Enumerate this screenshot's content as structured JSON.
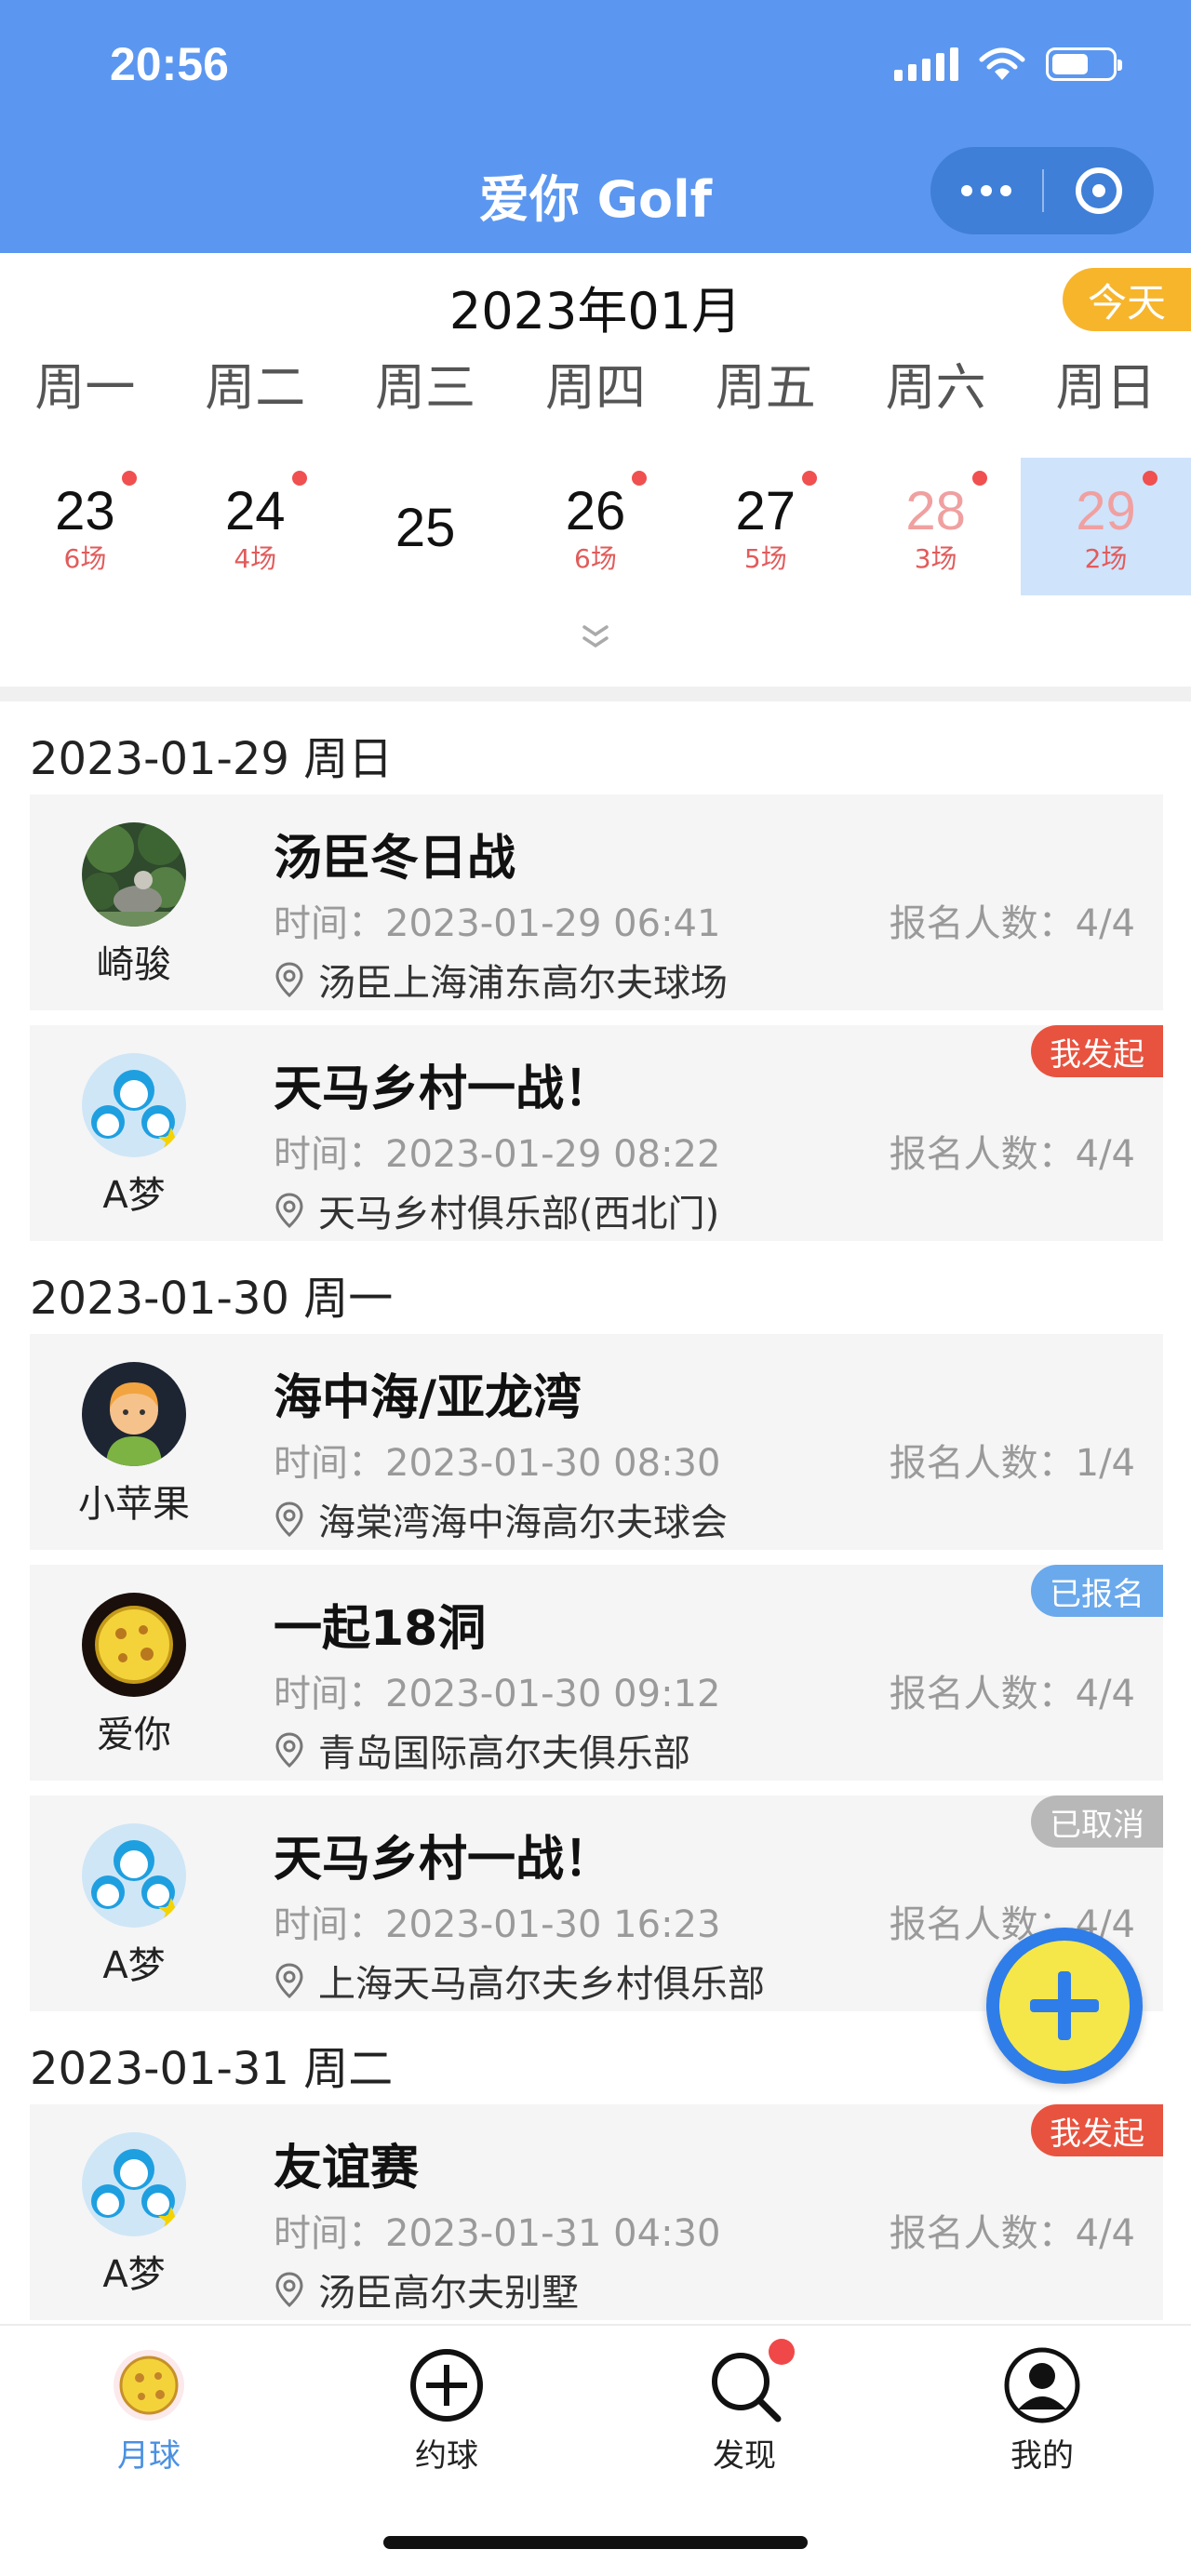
{
  "status_bar": {
    "time": "20:56"
  },
  "nav": {
    "title": "爱你 Golf"
  },
  "calendar": {
    "month": "2023年01月",
    "today_label": "今天",
    "weekdays": [
      "周一",
      "周二",
      "周三",
      "周四",
      "周五",
      "周六",
      "周日"
    ],
    "days": [
      {
        "num": "23",
        "count": "6场"
      },
      {
        "num": "24",
        "count": "4场"
      },
      {
        "num": "25",
        "count": ""
      },
      {
        "num": "26",
        "count": "6场"
      },
      {
        "num": "27",
        "count": "5场"
      },
      {
        "num": "28",
        "count": "3场"
      },
      {
        "num": "29",
        "count": "2场"
      }
    ]
  },
  "sections": [
    {
      "date": "2023-01-29 周日",
      "cards": [
        {
          "nick": "崎骏",
          "title": "汤臣冬日战",
          "time": "时间：2023-01-29 06:41",
          "count": "报名人数：4/4",
          "location": "汤臣上海浦东高尔夫球场",
          "badge": ""
        },
        {
          "nick": "A梦",
          "title": "天马乡村一战！",
          "time": "时间：2023-01-29 08:22",
          "count": "报名人数：4/4",
          "location": "天马乡村俱乐部(西北门)",
          "badge": "我发起"
        }
      ]
    },
    {
      "date": "2023-01-30 周一",
      "cards": [
        {
          "nick": "小苹果",
          "title": "海中海/亚龙湾",
          "time": "时间：2023-01-30 08:30",
          "count": "报名人数：1/4",
          "location": "海棠湾海中海高尔夫球会",
          "badge": ""
        },
        {
          "nick": "爱你",
          "title": "一起18洞",
          "time": "时间：2023-01-30 09:12",
          "count": "报名人数：4/4",
          "location": "青岛国际高尔夫俱乐部",
          "badge": "已报名"
        },
        {
          "nick": "A梦",
          "title": "天马乡村一战！",
          "time": "时间：2023-01-30 16:23",
          "count": "报名人数：4/4",
          "location": "上海天马高尔夫乡村俱乐部",
          "badge": "已取消"
        }
      ]
    },
    {
      "date": "2023-01-31 周二",
      "cards": [
        {
          "nick": "A梦",
          "title": "友谊赛",
          "time": "时间：2023-01-31 04:30",
          "count": "报名人数：4/4",
          "location": "汤臣高尔夫别墅",
          "badge": "我发起"
        }
      ]
    }
  ],
  "badge_colors": {
    "我发起": "#e8533f",
    "已报名": "#6aa9ec",
    "已取消": "#b8b8b8"
  },
  "tabs": [
    {
      "label": "月球",
      "icon": "moon-ball-icon"
    },
    {
      "label": "约球",
      "icon": "plus-circle-icon"
    },
    {
      "label": "发现",
      "icon": "search-icon"
    },
    {
      "label": "我的",
      "icon": "user-icon"
    }
  ],
  "accent_color": "#5b97f0"
}
